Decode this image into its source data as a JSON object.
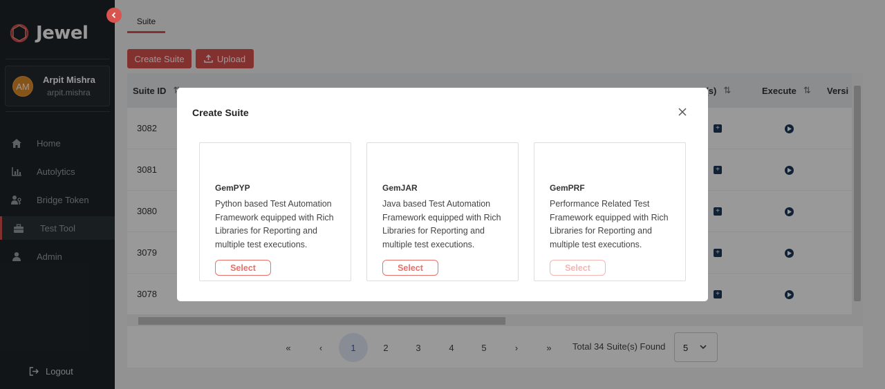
{
  "app": {
    "name": "Jewel"
  },
  "user": {
    "initials": "AM",
    "name": "Arpit Mishra",
    "username": "arpit.mishra"
  },
  "sidebar": {
    "items": [
      {
        "label": "Home",
        "icon": "home-icon"
      },
      {
        "label": "Autolytics",
        "icon": "chart-icon"
      },
      {
        "label": "Bridge Token",
        "icon": "users-key-icon"
      },
      {
        "label": "Test Tool",
        "icon": "toolbox-icon",
        "active": true
      },
      {
        "label": "Admin",
        "icon": "user-icon"
      }
    ],
    "logout_label": "Logout"
  },
  "page": {
    "tab_label": "Suite",
    "create_suite_label": "Create Suite",
    "upload_label": "Upload"
  },
  "table": {
    "columns": [
      "Suite ID",
      "Testcase(s)",
      "Execute",
      "Versi"
    ],
    "visible_column_fragments": {
      "testcases_visible": "se(s)"
    },
    "rows": [
      {
        "suite_id": "3082"
      },
      {
        "suite_id": "3081"
      },
      {
        "suite_id": "3080"
      },
      {
        "suite_id": "3079"
      },
      {
        "suite_id": "3078"
      }
    ]
  },
  "pagination": {
    "first": "«",
    "prev": "‹",
    "pages": [
      "1",
      "2",
      "3",
      "4",
      "5"
    ],
    "current": "1",
    "next": "›",
    "last": "»",
    "total_text": "Total 34 Suite(s) Found",
    "page_size": "5"
  },
  "modal": {
    "title": "Create Suite",
    "cards": [
      {
        "name": "GemPYP",
        "description": "Python based Test Automation Framework equipped with Rich Libraries for Reporting and multiple test executions.",
        "button": "Select",
        "enabled": true
      },
      {
        "name": "GemJAR",
        "description": "Java based Test Automation Framework equipped with Rich Libraries for Reporting and multiple test executions.",
        "button": "Select",
        "enabled": true
      },
      {
        "name": "GemPRF",
        "description": "Performance Related Test Framework equipped with Rich Libraries for Reporting and multiple test executions.",
        "button": "Select",
        "enabled": false
      }
    ]
  },
  "colors": {
    "accent": "#d9534f",
    "sidebar_bg": "#1f2428",
    "icon_navy": "#1d3a5c"
  }
}
